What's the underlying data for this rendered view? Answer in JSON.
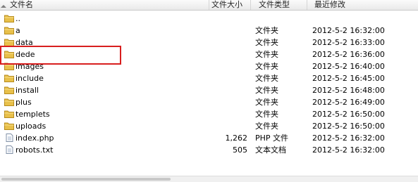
{
  "columns": {
    "name": "文件名",
    "size": "文件大小",
    "type": "文件类型",
    "modified": "最近修改"
  },
  "files": [
    {
      "name": "..",
      "size": "",
      "type": "",
      "modified": "",
      "kind": "folder-up"
    },
    {
      "name": "a",
      "size": "",
      "type": "文件夹",
      "modified": "2012-5-2 16:32:00",
      "kind": "folder"
    },
    {
      "name": "data",
      "size": "",
      "type": "文件夹",
      "modified": "2012-5-2 16:33:00",
      "kind": "folder"
    },
    {
      "name": "dede",
      "size": "",
      "type": "文件夹",
      "modified": "2012-5-2 16:36:00",
      "kind": "folder"
    },
    {
      "name": "images",
      "size": "",
      "type": "文件夹",
      "modified": "2012-5-2 16:40:00",
      "kind": "folder"
    },
    {
      "name": "include",
      "size": "",
      "type": "文件夹",
      "modified": "2012-5-2 16:45:00",
      "kind": "folder"
    },
    {
      "name": "install",
      "size": "",
      "type": "文件夹",
      "modified": "2012-5-2 16:48:00",
      "kind": "folder"
    },
    {
      "name": "plus",
      "size": "",
      "type": "文件夹",
      "modified": "2012-5-2 16:49:00",
      "kind": "folder"
    },
    {
      "name": "templets",
      "size": "",
      "type": "文件夹",
      "modified": "2012-5-2 16:50:00",
      "kind": "folder"
    },
    {
      "name": "uploads",
      "size": "",
      "type": "文件夹",
      "modified": "2012-5-2 16:50:00",
      "kind": "folder"
    },
    {
      "name": "index.php",
      "size": "1,262",
      "type": "PHP 文件",
      "modified": "2012-5-2 16:32:00",
      "kind": "file"
    },
    {
      "name": "robots.txt",
      "size": "505",
      "type": "文本文档",
      "modified": "2012-5-2 16:32:00",
      "kind": "file"
    }
  ],
  "colors": {
    "folder": "#e8c04a",
    "folder_dark": "#b58a1c",
    "highlight": "#d81e1e"
  }
}
